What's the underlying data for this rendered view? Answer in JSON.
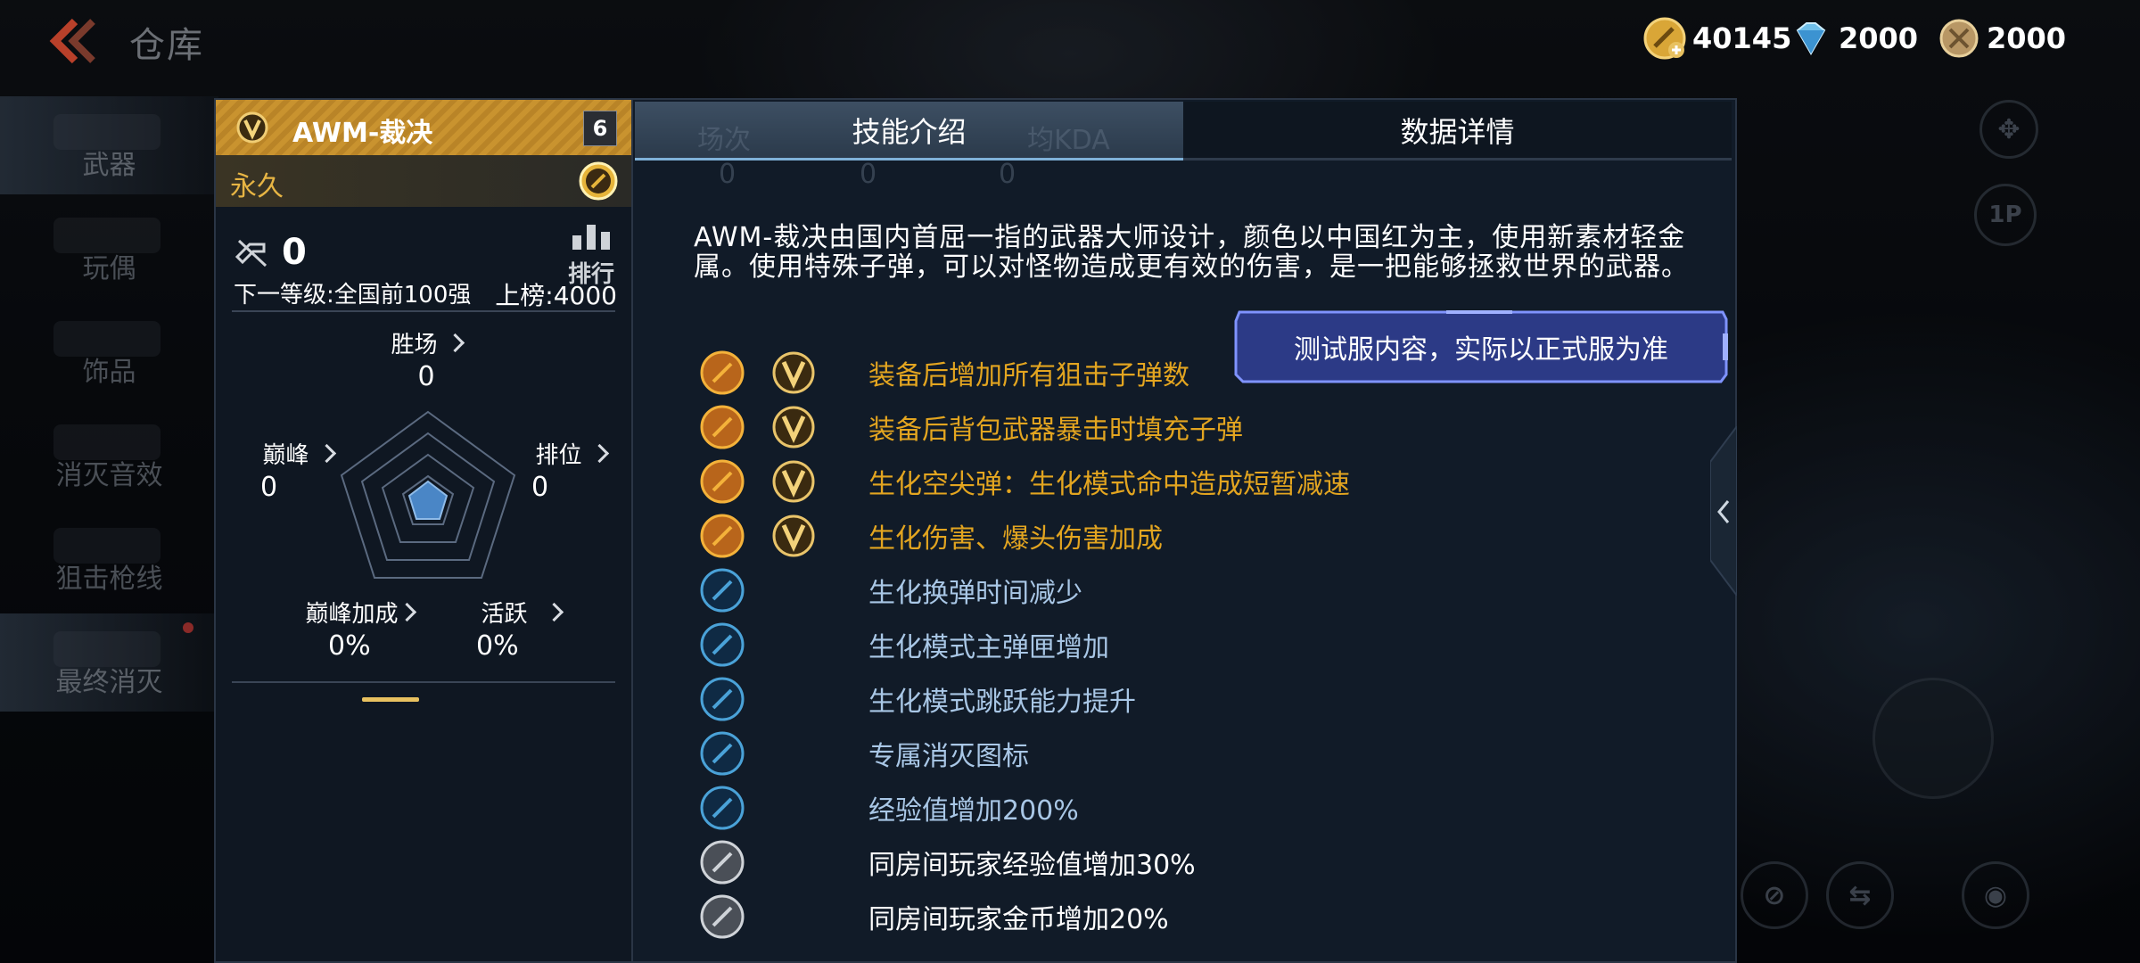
{
  "top": {
    "title": "仓库",
    "currency": [
      {
        "icon": "gold-coin-icon",
        "value": "40145"
      },
      {
        "icon": "diamond-icon",
        "value": "2000"
      },
      {
        "icon": "medal-icon",
        "value": "2000"
      }
    ]
  },
  "sidebar": {
    "items": [
      {
        "label": "武器",
        "active": true
      },
      {
        "label": "玩偶"
      },
      {
        "label": "饰品"
      },
      {
        "label": "消灭音效"
      },
      {
        "label": "狙击枪线"
      },
      {
        "label": "最终消灭",
        "active": true
      }
    ]
  },
  "weapon": {
    "name": "AWM-裁决",
    "level": "6",
    "duration": "永久",
    "kills": "0",
    "rank_label": "排行",
    "next_level": "下一等级:全国前100强",
    "rank_threshold": "上榜:4000",
    "stats": {
      "wins": {
        "label": "胜场",
        "value": "0"
      },
      "peak": {
        "label": "巅峰",
        "value": "0"
      },
      "ranked": {
        "label": "排位",
        "value": "0"
      },
      "peak_bonus": {
        "label": "巅峰加成",
        "value": "0%"
      },
      "active": {
        "label": "活跃",
        "value": "0%"
      }
    }
  },
  "tabs": [
    {
      "label": "技能介绍",
      "active": true
    },
    {
      "label": "数据详情",
      "active": false
    }
  ],
  "ghost_headers": [
    "场次",
    "均KDA"
  ],
  "ghost_values": [
    "0",
    "0",
    "0"
  ],
  "description": "AWM-裁决由国内首屈一指的武器大师设计，颜色以中国红为主，使用新素材轻金属。使用特殊子弹，可以对怪物造成更有效的伤害，是一把能够拯救世界的武器。",
  "tooltip": "测试服内容，实际以正式服为准",
  "skills": [
    {
      "text": "装备后增加所有狙击子弹数",
      "tier": "gold",
      "icon": "sniper-bullet-icon"
    },
    {
      "text": "装备后背包武器暴击时填充子弹",
      "tier": "gold",
      "icon": "crit-refill-icon"
    },
    {
      "text": "生化空尖弹：生化模式命中造成短暂减速",
      "tier": "gold",
      "icon": "hollow-point-icon"
    },
    {
      "text": "生化伤害、爆头伤害加成",
      "tier": "gold",
      "icon": "headshot-damage-icon"
    },
    {
      "text": "生化换弹时间减少",
      "tier": "blue",
      "icon": "reload-speed-icon"
    },
    {
      "text": "生化模式主弹匣增加",
      "tier": "blue",
      "icon": "magazine-up-icon"
    },
    {
      "text": "生化模式跳跃能力提升",
      "tier": "blue",
      "icon": "jump-boost-icon"
    },
    {
      "text": "专属消灭图标",
      "tier": "blue",
      "icon": "kill-icon-badge-icon"
    },
    {
      "text": "经验值增加200%",
      "tier": "blue",
      "icon": "exp-boost-icon"
    },
    {
      "text": "同房间玩家经验值增加30%",
      "tier": "grey",
      "icon": "room-exp-icon"
    },
    {
      "text": "同房间玩家金币增加20%",
      "tier": "grey",
      "icon": "room-gold-icon"
    }
  ],
  "colors": {
    "gold_text": "#e3a520",
    "blue_text": "#a9c7e6",
    "grey_text": "#ffffff",
    "accent_tab": "#7fb1d8"
  }
}
